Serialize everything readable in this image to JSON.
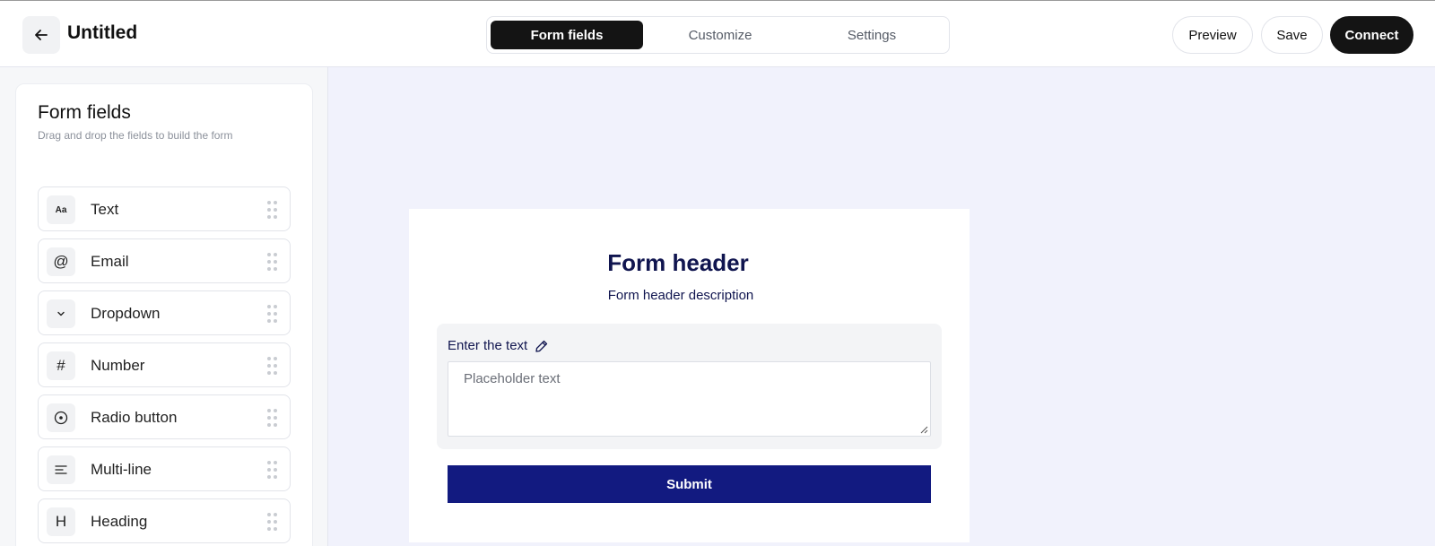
{
  "header": {
    "title": "Untitled",
    "back_icon": "arrow-left-icon",
    "tabs": [
      {
        "label": "Form fields",
        "active": true
      },
      {
        "label": "Customize",
        "active": false
      },
      {
        "label": "Settings",
        "active": false
      }
    ],
    "preview_label": "Preview",
    "save_label": "Save",
    "connect_label": "Connect"
  },
  "sidebar": {
    "title": "Form fields",
    "subtitle": "Drag and drop the fields to build the form",
    "items": [
      {
        "label": "Text",
        "icon": "text-aa-icon",
        "glyph": "Aa"
      },
      {
        "label": "Email",
        "icon": "at-sign-icon",
        "glyph": "@"
      },
      {
        "label": "Dropdown",
        "icon": "chevron-down-icon",
        "glyph": ""
      },
      {
        "label": "Number",
        "icon": "hash-icon",
        "glyph": "#"
      },
      {
        "label": "Radio button",
        "icon": "radio-icon",
        "glyph": ""
      },
      {
        "label": "Multi-line",
        "icon": "align-left-icon",
        "glyph": ""
      },
      {
        "label": "Heading",
        "icon": "heading-icon",
        "glyph": "H"
      }
    ]
  },
  "form": {
    "header": "Form header",
    "description": "Form header description",
    "field_label": "Enter the text",
    "field_placeholder": "Placeholder text",
    "submit_label": "Submit"
  },
  "colors": {
    "accent_dark": "#141414",
    "submit_blue": "#121a80",
    "form_text": "#10154f",
    "canvas_bg": "#f1f2fc"
  }
}
